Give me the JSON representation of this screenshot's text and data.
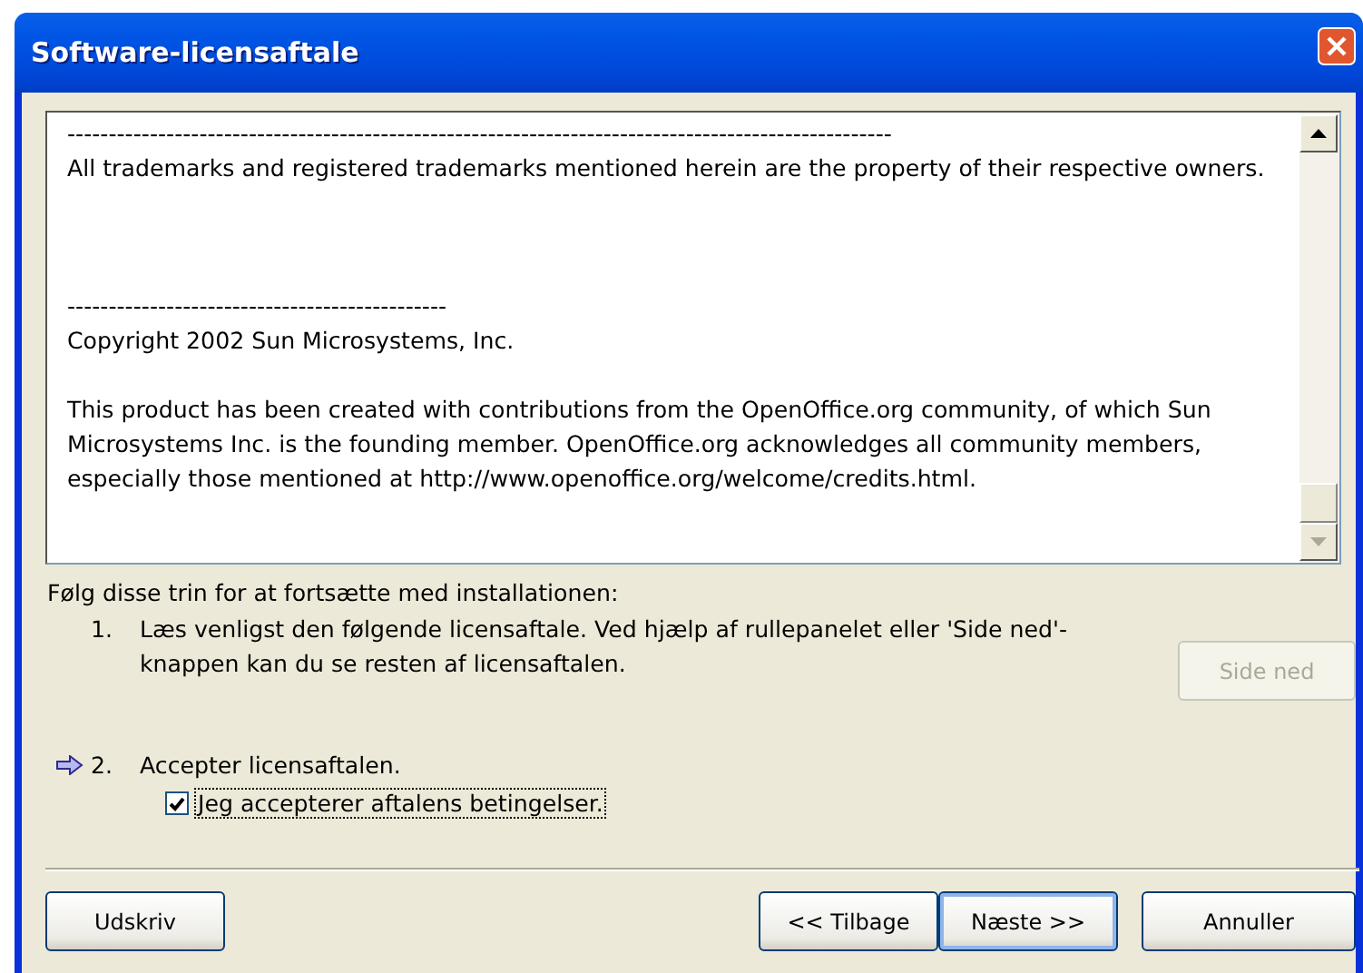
{
  "window": {
    "title": "Software-licensaftale"
  },
  "license_text": [
    {
      "kind": "rule",
      "text": "----------------------------------------------------------------------------------------------------"
    },
    {
      "kind": "para",
      "text": "All trademarks and registered trademarks mentioned herein are the property of their respective owners."
    },
    {
      "kind": "rule",
      "text": "----------------------------------------------"
    },
    {
      "kind": "para",
      "text": "Copyright 2002 Sun Microsystems, Inc."
    },
    {
      "kind": "para",
      "text": "This product has been created with contributions from the OpenOffice.org community, of which Sun Microsystems Inc. is the founding member. OpenOffice.org acknowledges all community members, especially those mentioned at http://www.openoffice.org/welcome/credits.html."
    }
  ],
  "instructions": "Følg disse trin for at fortsætte med installationen:",
  "steps": [
    {
      "number": "1.",
      "text": "Læs venligst den følgende licensaftale. Ved hjælp af rullepanelet eller 'Side ned'-knappen kan du se resten af licensaftalen.",
      "current": false
    },
    {
      "number": "2.",
      "text": "Accepter licensaftalen.",
      "current": true
    }
  ],
  "page_down_button": {
    "label": "Side ned",
    "disabled": true
  },
  "accept_checkbox": {
    "label": "Jeg accepterer aftalens betingelser.",
    "checked": true
  },
  "buttons": [
    {
      "label": "Udskriv",
      "default": false
    },
    {
      "label": "<< Tilbage",
      "default": false
    },
    {
      "label": "Næste >>",
      "default": true
    },
    {
      "label": "Annuller",
      "default": false
    }
  ]
}
